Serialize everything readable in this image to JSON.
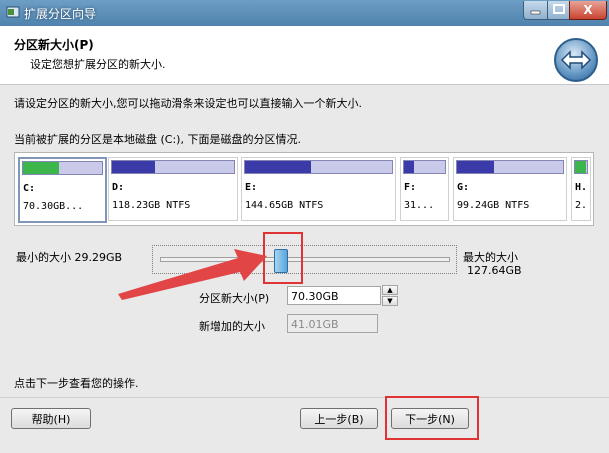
{
  "window": {
    "title": "扩展分区向导",
    "close_label": "X"
  },
  "header": {
    "title": "分区新大小(P)",
    "subtitle": "设定您想扩展分区的新大小."
  },
  "instruction": "请设定分区的新大小,您可以拖动滑条来设定也可以直接输入一个新大小.",
  "disk_description": "当前被扩展的分区是本地磁盘 (C:), 下面是磁盘的分区情况.",
  "partitions": [
    {
      "letter": "C:",
      "info": "70.30GB...",
      "usage": 0.45,
      "color": "#3cb54a"
    },
    {
      "letter": "D:",
      "info": "118.23GB NTFS",
      "usage": 0.35,
      "color": "#3a3aa8"
    },
    {
      "letter": "E:",
      "info": "144.65GB NTFS",
      "usage": 0.45,
      "color": "#3a3aa8"
    },
    {
      "letter": "F:",
      "info": "31...",
      "usage": 0.25,
      "color": "#3a3aa8"
    },
    {
      "letter": "G:",
      "info": "99.24GB NTFS",
      "usage": 0.35,
      "color": "#3a3aa8"
    },
    {
      "letter": "H.",
      "info": "2.",
      "usage": 0.9,
      "color": "#3cb54a"
    }
  ],
  "slider": {
    "min_label": "最小的大小 29.29GB",
    "max_label": "最大的大小",
    "max_value": "127.64GB"
  },
  "new_size": {
    "label": "分区新大小(P)",
    "value": "70.30GB"
  },
  "added_size": {
    "label": "新增加的大小",
    "value": "41.01GB"
  },
  "footer_hint": "点击下一步查看您的操作.",
  "buttons": {
    "help": "帮助(H)",
    "back": "上一步(B)",
    "next": "下一步(N)"
  }
}
